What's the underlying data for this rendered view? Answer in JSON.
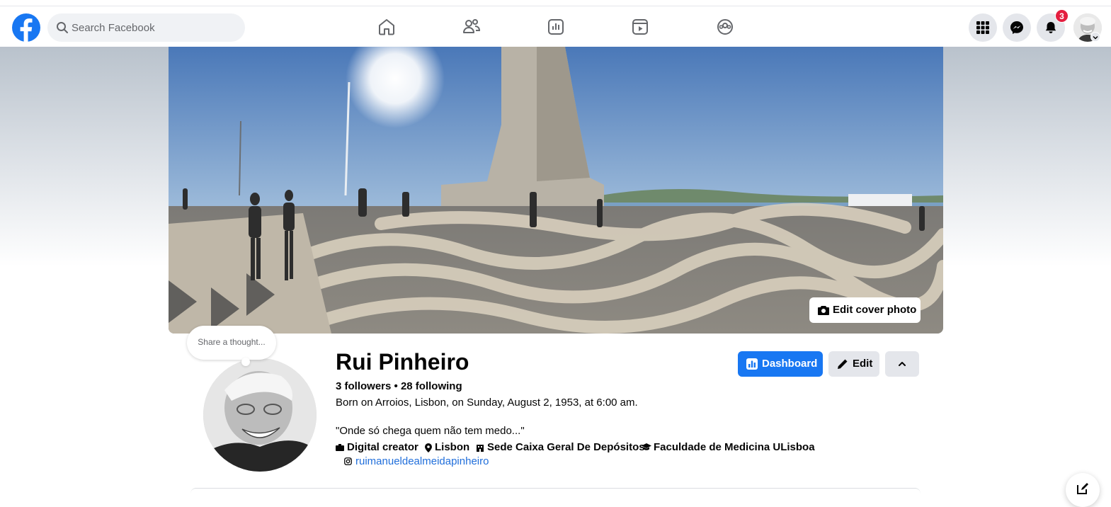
{
  "search": {
    "placeholder": "Search Facebook"
  },
  "nav": {
    "icons": [
      "home-icon",
      "friends-icon",
      "dashboard-icon",
      "video-icon",
      "groups-icon"
    ]
  },
  "header_right": {
    "menu_icon": "grid-menu-icon",
    "messenger_icon": "messenger-icon",
    "notifications_icon": "bell-icon",
    "notification_count": "3"
  },
  "cover": {
    "edit_label": "Edit cover photo"
  },
  "profile": {
    "thought_placeholder": "Share a thought...",
    "name": "Rui Pinheiro",
    "follow_stats": "3 followers • 28 following",
    "born": "Born on Arroios, Lisbon, on Sunday, August 2, 1953, at 6:00 am.",
    "quote": "\"Onde só chega quem não tem medo...\"",
    "details": [
      {
        "icon": "briefcase-icon",
        "text": "Digital creator"
      },
      {
        "icon": "location-pin-icon",
        "text": "Lisbon"
      },
      {
        "icon": "building-icon",
        "text": "Sede Caixa Geral De Depósitos"
      },
      {
        "icon": "graduation-cap-icon",
        "text": "Faculdade de Medicina ULisboa"
      }
    ],
    "instagram": "ruimanueldealmeidapinheiro"
  },
  "actions": {
    "dashboard_label": "Dashboard",
    "edit_label": "Edit"
  },
  "colors": {
    "brand": "#1877f2",
    "badge": "#e41e3f",
    "link": "#216fdb"
  }
}
